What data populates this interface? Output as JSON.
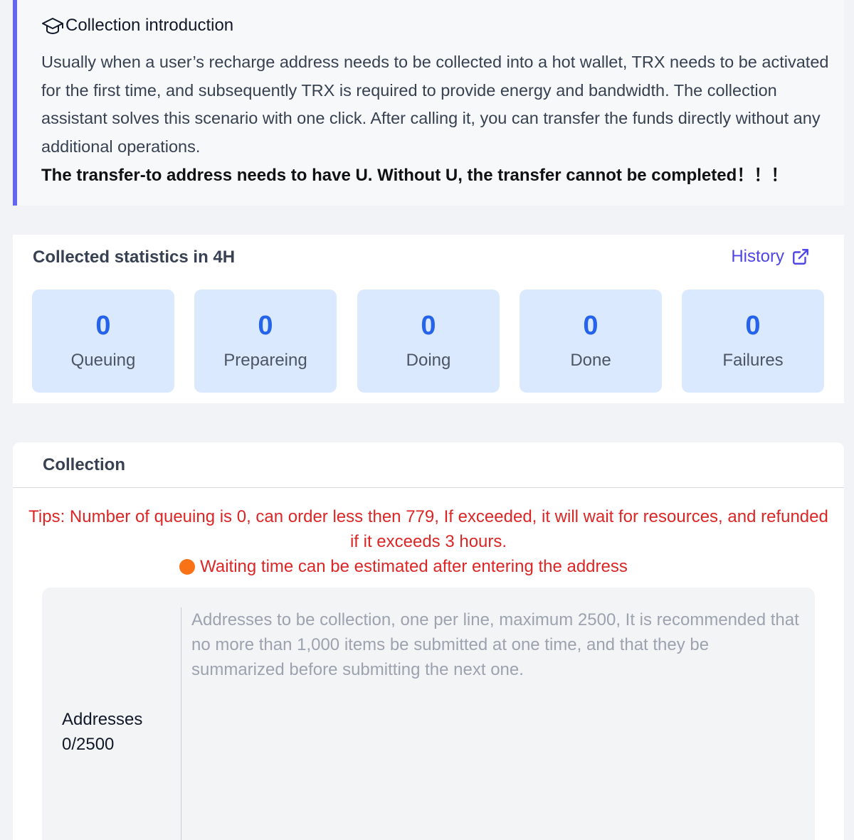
{
  "intro": {
    "title": "Collection introduction",
    "icon": "graduation-cap-icon",
    "body": "Usually when a user’s recharge address needs to be collected into a hot wallet, TRX needs to be activated for the first time, and subsequently TRX is required to provide energy and bandwidth. The collection assistant solves this scenario with one click. After calling it, you can transfer the funds directly without any additional operations.",
    "warning": "The transfer-to address needs to have U. Without U, the transfer cannot be completed！！！",
    "accent_color": "#6366f1"
  },
  "stats": {
    "title": "Collected statistics in 4H",
    "history_label": "History",
    "history_icon": "external-link-icon",
    "cards": [
      {
        "value": "0",
        "label": "Queuing"
      },
      {
        "value": "0",
        "label": "Prepareing"
      },
      {
        "value": "0",
        "label": "Doing"
      },
      {
        "value": "0",
        "label": "Done"
      },
      {
        "value": "0",
        "label": "Failures"
      }
    ],
    "card_bg_color": "#dbe9fe",
    "value_color": "#2563eb"
  },
  "collection": {
    "title": "Collection",
    "tips": "Tips: Number of queuing is 0, can order less then 779, If exceeded, it will wait for resources, and refunded if it exceeds 3 hours.",
    "wait_text": "Waiting time can be estimated after entering the address",
    "wait_dot_color": "#f97316",
    "tips_color": "#dc2626",
    "addresses_label": "Addresses",
    "addresses_count": "0/2500",
    "addresses_placeholder": "Addresses to be collection, one per line, maximum 2500, It is recommended that no more than 1,000 items be submitted at one time, and that they be summarized before submitting the next one.",
    "addresses_value": ""
  }
}
